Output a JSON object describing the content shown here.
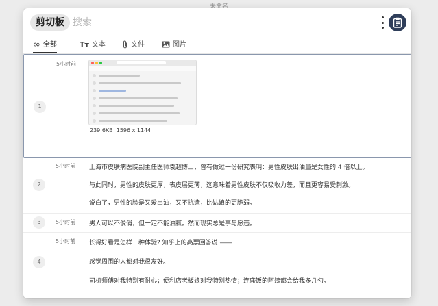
{
  "window_title": "未命名",
  "header": {
    "title": "剪切板",
    "search_placeholder": "搜索",
    "icons": {
      "more": "more-vertical-icon",
      "app": "clipboard-app-icon"
    }
  },
  "tabs": [
    {
      "icon": "∞",
      "label": "全部"
    },
    {
      "icon": "Tт",
      "label": "文本"
    },
    {
      "icon": "paperclip-icon",
      "label": "文件"
    },
    {
      "icon": "image-icon",
      "label": "图片"
    }
  ],
  "items": [
    {
      "index": "1",
      "time": "5小时前",
      "type": "image",
      "size": "239.6KB",
      "dimensions": "1596 x 1144"
    },
    {
      "index": "2",
      "time": "5小时前",
      "type": "text",
      "lines": [
        "上海市皮肤病医院副主任医师袁超博士，曾有做过一份研究表明：男性皮肤出油量是女性的 4 倍以上。",
        "与此同时，男性的皮肤更厚，表皮层更薄，这意味着男性皮肤不仅吸收力差，而且更容易受刺激。",
        "说白了，男性的脸是又爱出油，又不抗造，比姑娘的更脆弱。"
      ]
    },
    {
      "index": "3",
      "time": "5小时前",
      "type": "text",
      "lines": [
        "男人可以不俊俏，但一定不能油腻。然而现实总是事与愿违。"
      ]
    },
    {
      "index": "4",
      "time": "5小时前",
      "type": "text",
      "lines": [
        "长得好看是怎样一种体验? 知乎上的高票回答说 ——",
        "感觉周围的人都对我很友好。",
        "司机师傅对我特别有耐心；便利店老板娘对我特别热情；连盛饭的阿姨都会给我多几勺。"
      ]
    }
  ],
  "colors": {
    "selected_border": "#8a97ad",
    "app_icon_bg": "#2f3e5a"
  }
}
